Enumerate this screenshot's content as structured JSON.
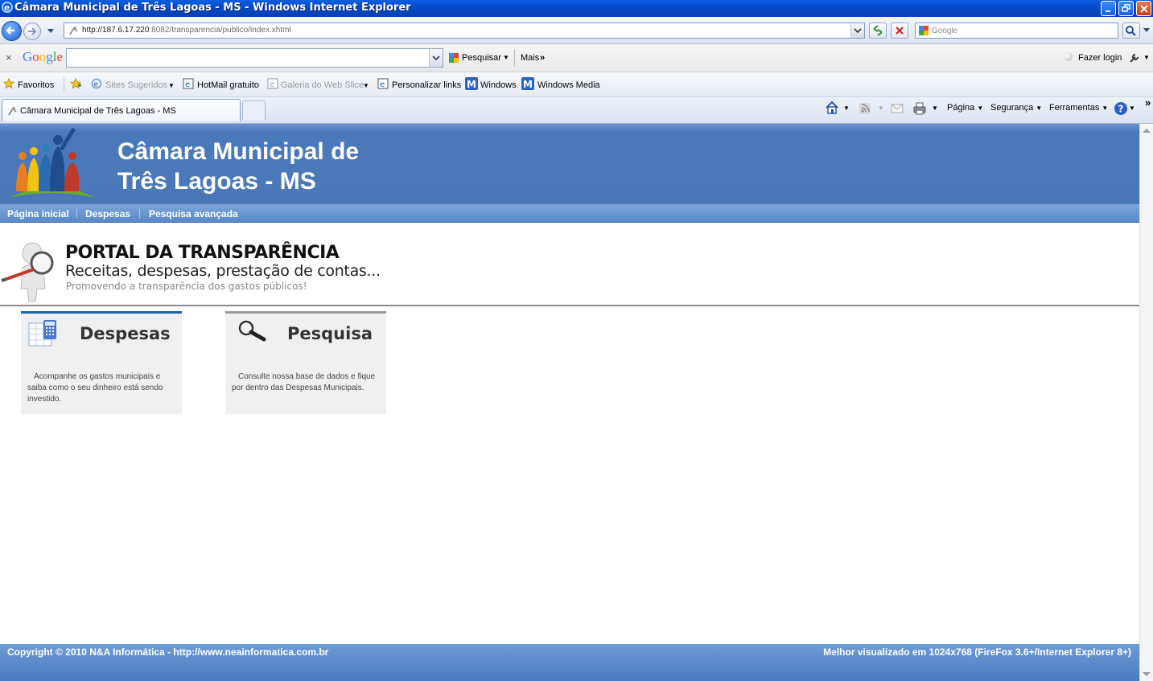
{
  "window": {
    "title": "Câmara Municipal de Três Lagoas - MS - Windows Internet Explorer"
  },
  "address_bar": {
    "url_host": "http://187.6.17.220",
    "url_rest": ":8082/transparencia/publico/index.xhtml",
    "search_placeholder": "Google"
  },
  "google_toolbar": {
    "logo": "Google",
    "search_label": "Pesquisar",
    "more_label": "Mais",
    "login_label": "Fazer login"
  },
  "favorites_bar": {
    "favorites_label": "Favoritos",
    "items": [
      {
        "label": "Sites Sugeridos",
        "dim": true
      },
      {
        "label": "HotMail gratuito",
        "dim": false
      },
      {
        "label": "Galeria do Web Slice",
        "dim": true
      },
      {
        "label": "Personalizar links",
        "dim": false
      },
      {
        "label": "Windows",
        "dim": false
      },
      {
        "label": "Windows Media",
        "dim": false
      }
    ]
  },
  "tabs": {
    "active_label": "Câmara Municipal de Três Lagoas - MS"
  },
  "command_bar": {
    "page_label": "Página",
    "security_label": "Segurança",
    "tools_label": "Ferramentas"
  },
  "site": {
    "title_line1": "Câmara Municipal de",
    "title_line2": "Três Lagoas - MS",
    "nav": [
      "Página inicial",
      "Despesas",
      "Pesquisa avançada"
    ],
    "portal_title": "PORTAL DA TRANSPARÊNCIA",
    "portal_subtitle": "Receitas, despesas, prestação de contas...",
    "portal_tagline": "Promovendo a transparência dos gastos públicos!",
    "cards": [
      {
        "title": "Despesas",
        "description": "Acompanhe os gastos municipais e saiba como o seu dinheiro está sendo investido."
      },
      {
        "title": "Pesquisa",
        "description": "Consulte nossa base de dados e fique por dentro das Despesas Municipais."
      }
    ],
    "footer_left": "Copyright © 2010 N&A Informática - http://www.neainformatica.com.br",
    "footer_right": "Melhor visualizado em 1024x768 (FireFox 3.6+/Internet Explorer 8+)"
  },
  "colors": {
    "header_blue": "#4a77b7",
    "titlebar_blue": "#0648c8",
    "card_bg": "#f0f0f0",
    "card1_accent": "#1f5fa8",
    "card2_accent": "#9a9a9a"
  }
}
